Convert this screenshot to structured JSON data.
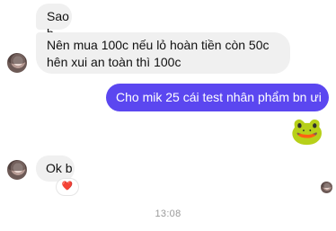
{
  "conversation": {
    "messages": [
      {
        "from": "them",
        "text": "Sao b"
      },
      {
        "from": "them",
        "text": "Nên mua 100c nếu lỏ hoàn tiền còn 50c hên xui an toàn thì 100c"
      },
      {
        "from": "me",
        "text": "Cho mik 25 cái test nhân phẩm bn ưi"
      },
      {
        "from": "me",
        "type": "sticker",
        "emoji": "🐸"
      },
      {
        "from": "them",
        "text": "Ok b",
        "reaction": "❤️"
      }
    ],
    "timestamp": "13:08"
  },
  "colors": {
    "outgoing_bubble": "#5b47f0",
    "incoming_bubble": "#f0f0f0",
    "reaction_heart": "#e0245e"
  },
  "icons": [
    "contact-avatar",
    "seen-avatar",
    "frog-sticker",
    "heart-reaction"
  ]
}
